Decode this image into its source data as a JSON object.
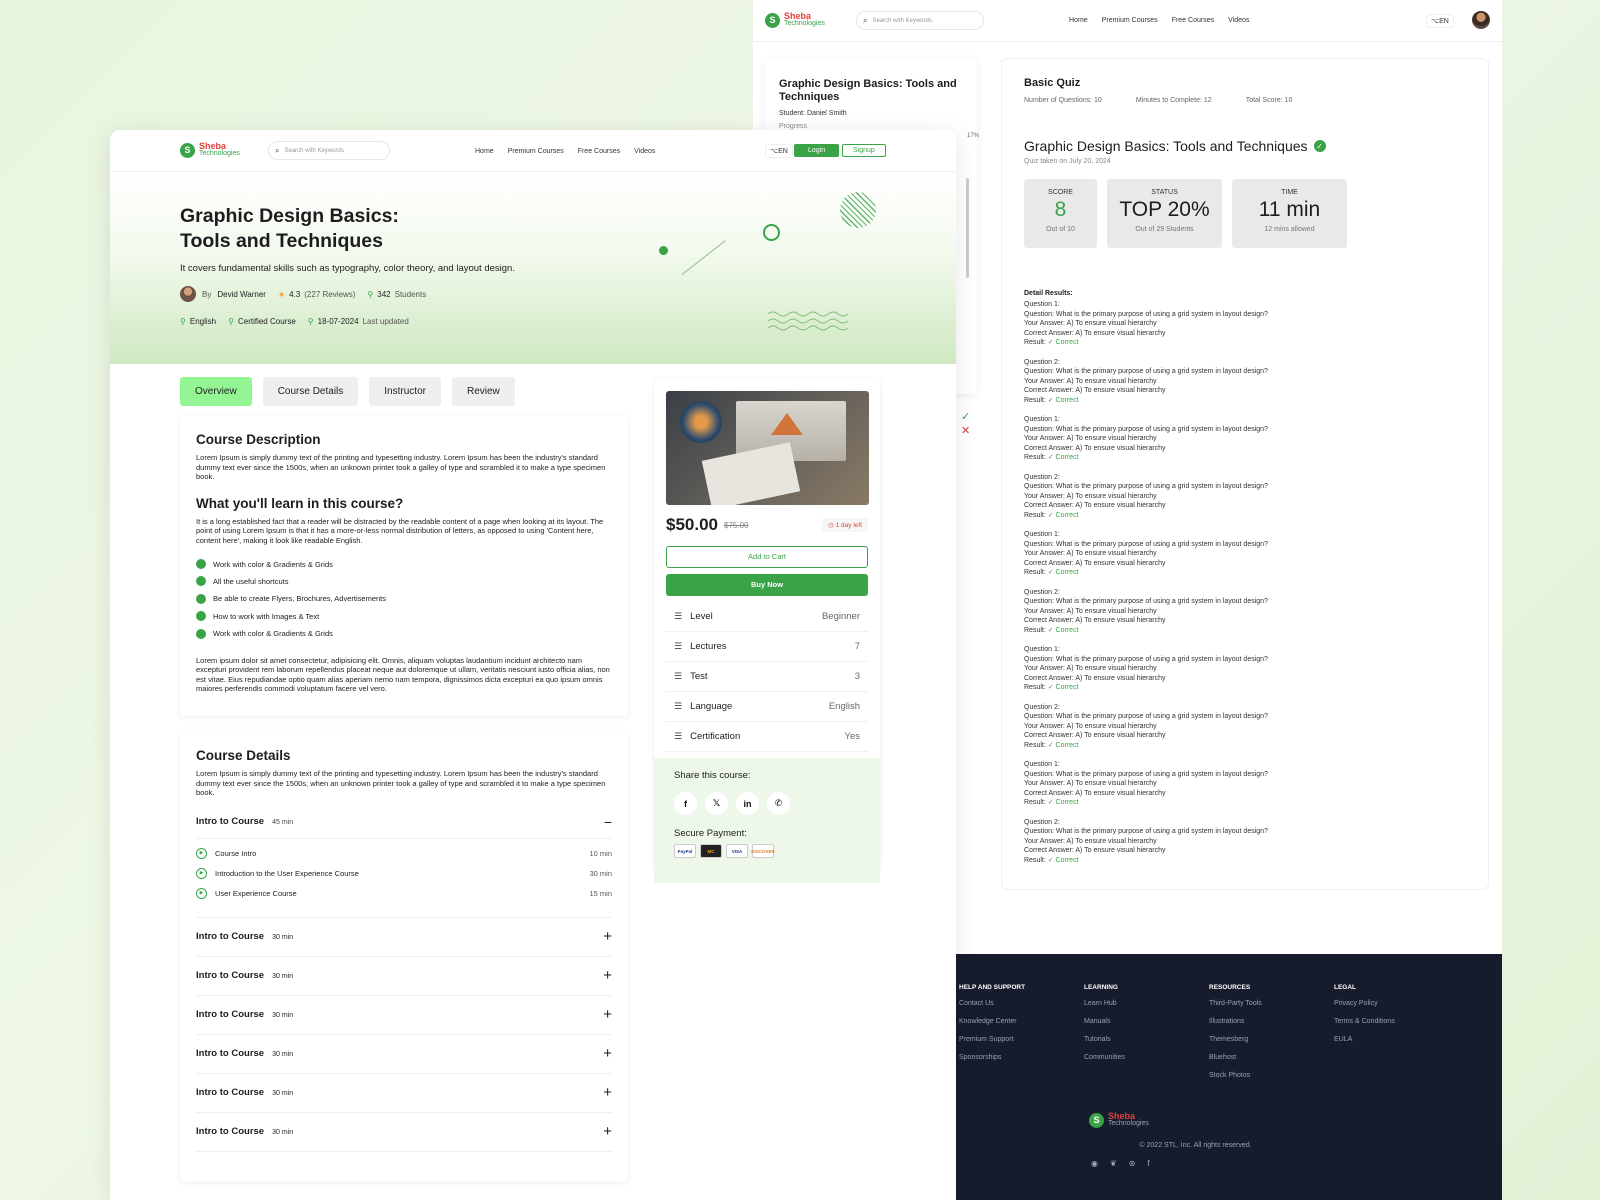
{
  "brand": {
    "line1": "Sheba",
    "line2": "Technologies",
    "mark": "S"
  },
  "search": {
    "placeholder": "Search with Keywords"
  },
  "nav": {
    "items": [
      "Home",
      "Premium Courses",
      "Free Courses",
      "Videos"
    ],
    "lang": "EN",
    "login": "Login",
    "signup": "Signup"
  },
  "colors": {
    "accent": "#3aa348",
    "accent_light": "#93f593",
    "danger": "#e0403a",
    "footer_bg": "#161c2c"
  },
  "quiz_page": {
    "progress_card": {
      "title": "Graphic Design Basics: Tools and Techniques",
      "student": "Student: Daniel Smith",
      "progress_label": "Progress",
      "percent": "17%"
    },
    "panel": {
      "title": "Basic Quiz",
      "meta": [
        "Number of Questions: 10",
        "Minutes to Complete: 12",
        "Total Score: 10"
      ],
      "course_title": "Graphic Design Basics: Tools and Techniques",
      "taken": "Quiz taken on July 20, 2024",
      "stats": [
        {
          "label": "SCORE",
          "value": "8",
          "sub": "Out of 10"
        },
        {
          "label": "STATUS",
          "value": "TOP 20%",
          "sub": "Out of 29 Students"
        },
        {
          "label": "TIME",
          "value": "11 min",
          "sub": "12 mins allowed"
        }
      ],
      "detail_title": "Detail Results:",
      "results": [
        {
          "q": "Question 1:",
          "text": "Question: What is the primary purpose of using a grid system in layout design?",
          "your": "Your Answer: A) To ensure visual hierarchy",
          "correct": "Correct Answer: A) To ensure visual hierarchy",
          "result_label": "Result:",
          "result": "✓ Correct"
        },
        {
          "q": "Question 2:",
          "text": "Question: What is the primary purpose of using a grid system in layout design?",
          "your": "Your Answer: A) To ensure visual hierarchy",
          "correct": "Correct Answer: A) To ensure visual hierarchy",
          "result_label": "Result:",
          "result": "✓ Correct"
        },
        {
          "q": "Question 1:",
          "text": "Question: What is the primary purpose of using a grid system in layout design?",
          "your": "Your Answer: A) To ensure visual hierarchy",
          "correct": "Correct Answer: A) To ensure visual hierarchy",
          "result_label": "Result:",
          "result": "✓ Correct"
        },
        {
          "q": "Question 2:",
          "text": "Question: What is the primary purpose of using a grid system in layout design?",
          "your": "Your Answer: A) To ensure visual hierarchy",
          "correct": "Correct Answer: A) To ensure visual hierarchy",
          "result_label": "Result:",
          "result": "✓ Correct"
        },
        {
          "q": "Question 1:",
          "text": "Question: What is the primary purpose of using a grid system in layout design?",
          "your": "Your Answer: A) To ensure visual hierarchy",
          "correct": "Correct Answer: A) To ensure visual hierarchy",
          "result_label": "Result:",
          "result": "✓ Correct"
        },
        {
          "q": "Question 2:",
          "text": "Question: What is the primary purpose of using a grid system in layout design?",
          "your": "Your Answer: A) To ensure visual hierarchy",
          "correct": "Correct Answer: A) To ensure visual hierarchy",
          "result_label": "Result:",
          "result": "✓ Correct"
        },
        {
          "q": "Question 1:",
          "text": "Question: What is the primary purpose of using a grid system in layout design?",
          "your": "Your Answer: A) To ensure visual hierarchy",
          "correct": "Correct Answer: A) To ensure visual hierarchy",
          "result_label": "Result:",
          "result": "✓ Correct"
        },
        {
          "q": "Question 2:",
          "text": "Question: What is the primary purpose of using a grid system in layout design?",
          "your": "Your Answer: A) To ensure visual hierarchy",
          "correct": "Correct Answer: A) To ensure visual hierarchy",
          "result_label": "Result:",
          "result": "✓ Correct"
        },
        {
          "q": "Question 1:",
          "text": "Question: What is the primary purpose of using a grid system in layout design?",
          "your": "Your Answer: A) To ensure visual hierarchy",
          "correct": "Correct Answer: A) To ensure visual hierarchy",
          "result_label": "Result:",
          "result": "✓ Correct"
        },
        {
          "q": "Question 2:",
          "text": "Question: What is the primary purpose of using a grid system in layout design?",
          "your": "Your Answer: A) To ensure visual hierarchy",
          "correct": "Correct Answer: A) To ensure visual hierarchy",
          "result_label": "Result:",
          "result": "✓ Correct"
        }
      ]
    },
    "side_marks": [
      "✓",
      "✕"
    ]
  },
  "footer": {
    "columns": [
      {
        "heading": "HELP AND SUPPORT",
        "items": [
          "Contact Us",
          "Knowledge Center",
          "Premium Support",
          "Sponsorships"
        ]
      },
      {
        "heading": "LEARNING",
        "items": [
          "Learn Hub",
          "Manuals",
          "Tutorials",
          "Communities"
        ]
      },
      {
        "heading": "RESOURCES",
        "items": [
          "Third-Party Tools",
          "Illustrations",
          "Themesberg",
          "Bluehost",
          "Stock Photos"
        ]
      },
      {
        "heading": "LEGAL",
        "items": [
          "Privacy Policy",
          "Terms & Conditions",
          "EULA"
        ]
      }
    ],
    "copyright": "© 2022 STL, Inc. All rights reserved.",
    "social_icons": [
      "github-icon",
      "twitter-icon",
      "dribbble-icon",
      "facebook-icon"
    ]
  },
  "course_page": {
    "hero": {
      "title_line1": "Graphic Design Basics:",
      "title_line2": "Tools and Techniques",
      "tagline": "It covers fundamental skills such as typography, color theory, and layout design.",
      "by": "By",
      "instructor": "Devid Warner",
      "rating": "4.3",
      "reviews": "(227 Reviews)",
      "students_count": "342",
      "students_label": "Students",
      "language": "English",
      "certified": "Certified Course",
      "updated_date": "18-07-2024",
      "updated_label": "Last updated"
    },
    "tabs": [
      "Overview",
      "Course Details",
      "Instructor",
      "Review"
    ],
    "description": {
      "title": "Course Description",
      "text": "Lorem Ipsum is simply dummy text of the printing and typesetting industry. Lorem Ipsum has been the industry's standard dummy text ever since the 1500s, when an unknown printer took a galley of type and scrambled it to make a type specimen book.",
      "learn_title": "What you'll learn in this course?",
      "learn_text": "It is a long established fact that a reader will be distracted by the readable content of a page when looking at its layout. The point of using Lorem Ipsum is that it has a more-or-less normal distribution of letters, as opposed to using 'Content here, content here', making it look like readable English.",
      "learn_items": [
        "Work with color & Gradients & Grids",
        "All the useful shortcuts",
        "Be able to create Flyers, Brochures, Advertisements",
        "How to work with Images & Text",
        "Work with color & Gradients & Grids"
      ],
      "closing_text": "Lorem ipsum dolor sit amet consectetur, adipisicing elit. Omnis, aliquam voluptas laudantium incidunt architecto nam excepturi provident rem laborum repellendus placeat neque aut doloremque ut ullam, veritatis nesciunt iusto officia alias, non est vitae. Eius repudiandae optio quam alias aperiam nemo nam tempora, dignissimos dicta excepturi ea quo ipsum omnis maiores perferendis commodi voluptatum facere vel vero."
    },
    "details": {
      "title": "Course Details",
      "text": "Lorem Ipsum is simply dummy text of the printing and typesetting industry. Lorem Ipsum has been the industry's standard dummy text ever since the 1500s, when an unknown printer took a galley of type and scrambled it to make a type specimen book.",
      "expanded_module": {
        "title": "Intro to Course",
        "duration": "45 min",
        "symbol": "−",
        "lessons": [
          {
            "title": "Course Intro",
            "duration": "10 min"
          },
          {
            "title": "Introduction to the User Experience Course",
            "duration": "30 min"
          },
          {
            "title": "User Experience Course",
            "duration": "15 min"
          }
        ]
      },
      "collapsed_modules": [
        {
          "title": "Intro to Course",
          "duration": "30 min",
          "symbol": "+"
        },
        {
          "title": "Intro to Course",
          "duration": "30 min",
          "symbol": "+"
        },
        {
          "title": "Intro to Course",
          "duration": "30 min",
          "symbol": "+"
        },
        {
          "title": "Intro to Course",
          "duration": "30 min",
          "symbol": "+"
        },
        {
          "title": "Intro to Course",
          "duration": "30 min",
          "symbol": "+"
        },
        {
          "title": "Intro to Course",
          "duration": "30 min",
          "symbol": "+"
        }
      ]
    },
    "purchase": {
      "price": "$50.00",
      "old_price": "$75.00",
      "timer": "1 day left",
      "add_to_cart": "Add to Cart",
      "buy_now": "Buy Now",
      "info": [
        {
          "label": "Level",
          "value": "Beginner"
        },
        {
          "label": "Lectures",
          "value": "7"
        },
        {
          "label": "Test",
          "value": "3"
        },
        {
          "label": "Language",
          "value": "English"
        },
        {
          "label": "Certification",
          "value": "Yes"
        }
      ],
      "share_title": "Share this course:",
      "share_icons": [
        "f",
        "𝕏",
        "in",
        "✆"
      ],
      "secure_payment": "Secure Payment:",
      "payment_methods": [
        "PayPal",
        "MC",
        "VISA",
        "DISCOVER"
      ]
    }
  }
}
